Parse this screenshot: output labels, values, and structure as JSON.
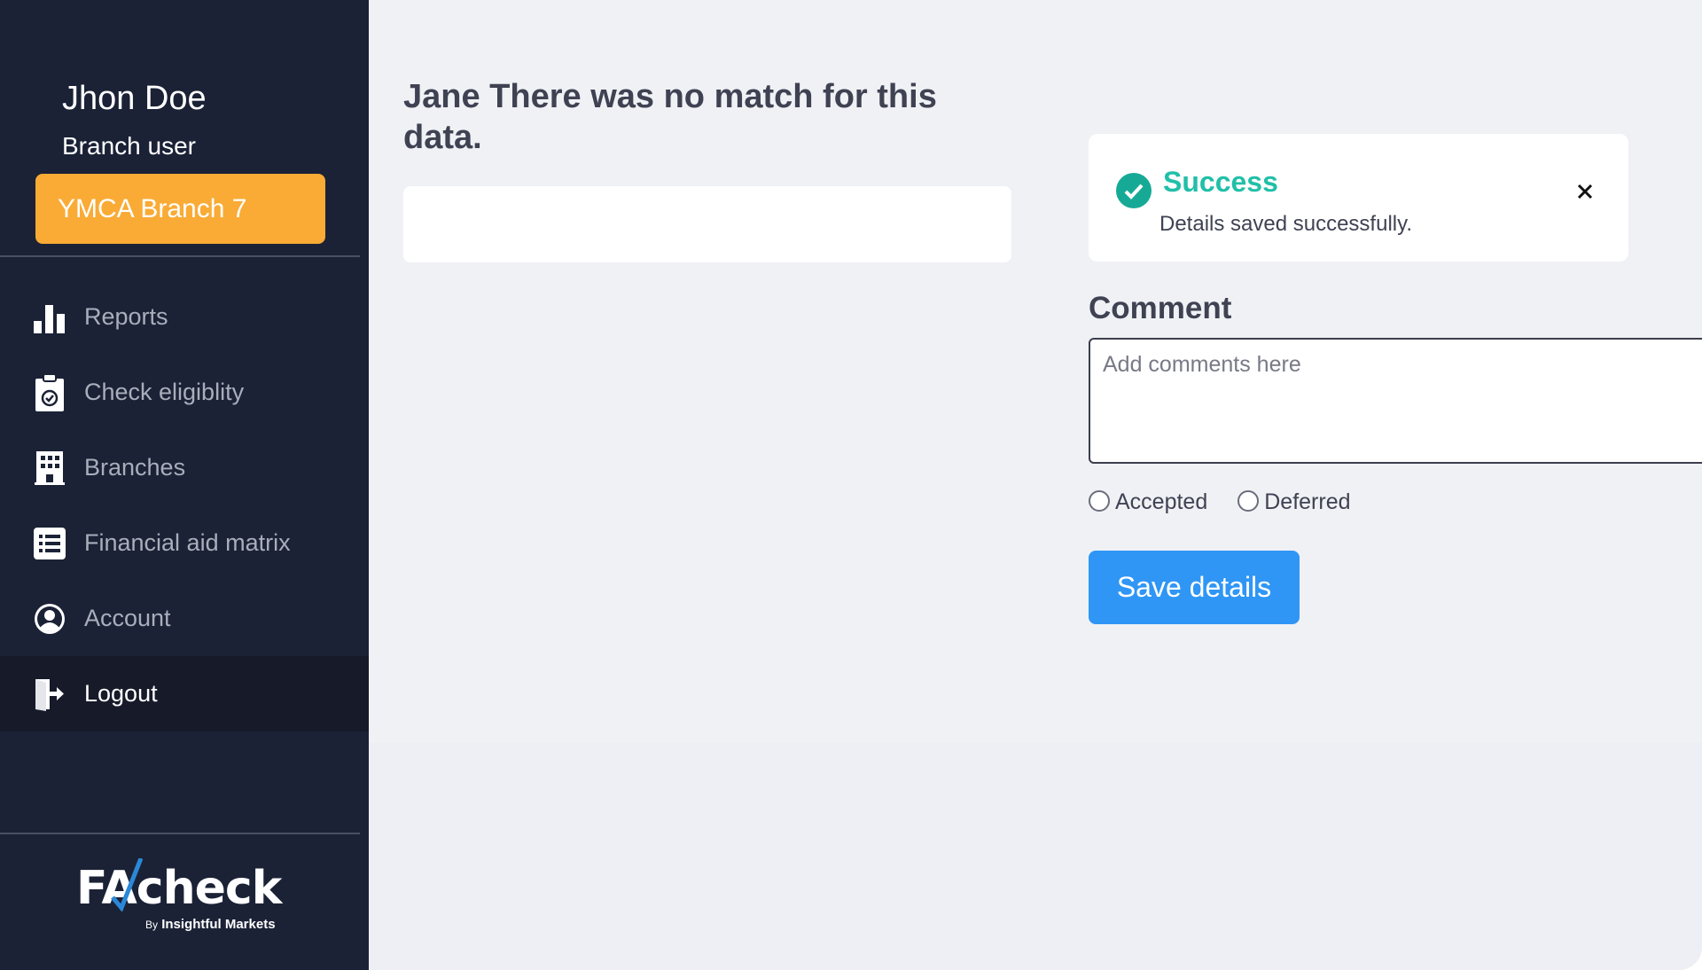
{
  "user": {
    "name": "Jhon Doe",
    "role": "Branch user",
    "branch": "YMCA Branch 7"
  },
  "nav": {
    "items": [
      {
        "label": "Reports",
        "icon": "bar-chart-icon"
      },
      {
        "label": "Check eligiblity",
        "icon": "clipboard-check-icon"
      },
      {
        "label": "Branches",
        "icon": "building-icon"
      },
      {
        "label": "Financial aid matrix",
        "icon": "list-icon"
      },
      {
        "label": "Account",
        "icon": "user-circle-icon"
      },
      {
        "label": "Logout",
        "icon": "logout-icon",
        "active": true
      }
    ]
  },
  "logo": {
    "main": "FAcheck",
    "by": "By",
    "company": "Insightful Markets"
  },
  "main": {
    "heading": "Jane There was no match for this data."
  },
  "toast": {
    "title": "Success",
    "message": "Details saved successfully."
  },
  "comment": {
    "label": "Comment",
    "placeholder": "Add comments here",
    "value": ""
  },
  "status_options": [
    "Accepted",
    "Deferred"
  ],
  "save_label": "Save details",
  "colors": {
    "sidebar": "#1b2236",
    "branch_button": "#f9ab35",
    "success": "#21bfa8",
    "primary_button": "#2f96f5",
    "background": "#f0f1f5"
  }
}
